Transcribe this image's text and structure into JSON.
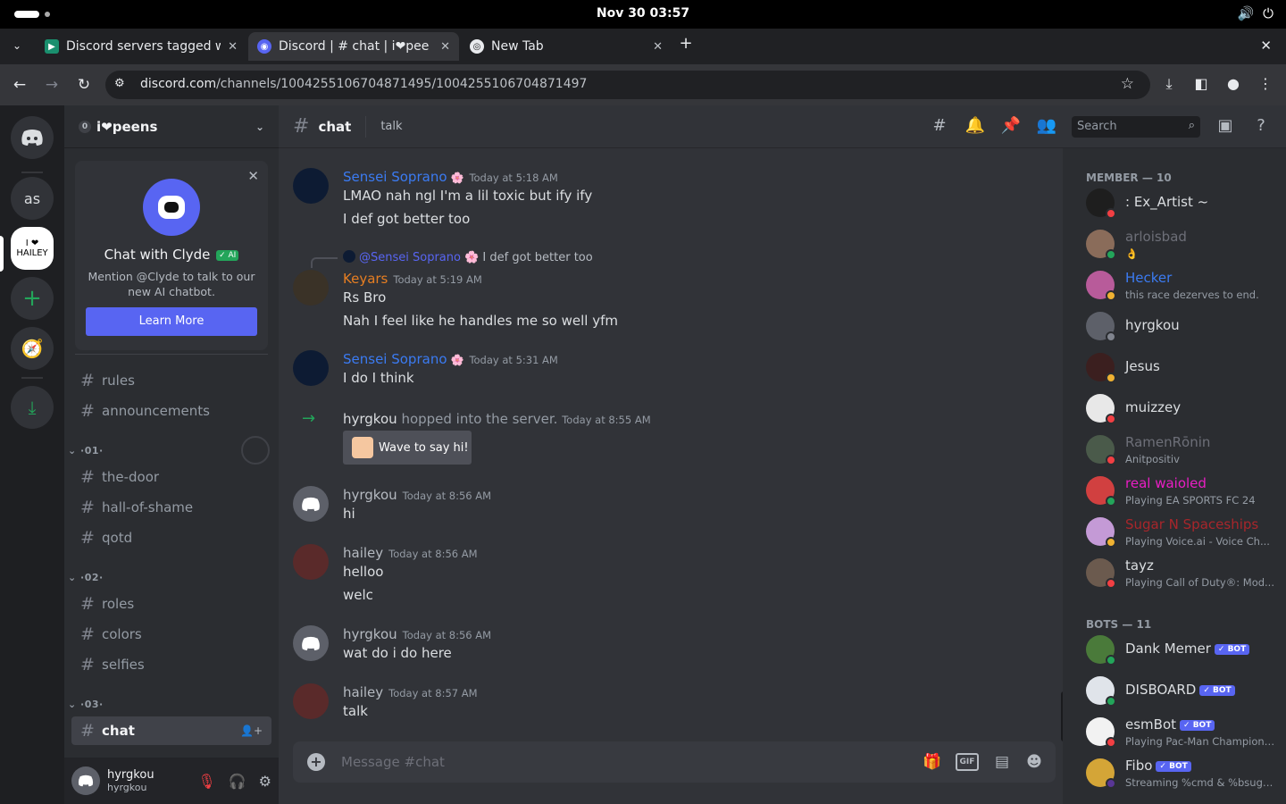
{
  "system": {
    "clock": "Nov 30  03:57",
    "volume_icon": "volume-icon",
    "power_icon": "power-icon"
  },
  "browser": {
    "tabs": [
      {
        "label": "Discord servers tagged w",
        "active": false
      },
      {
        "label": "Discord | # chat | i❤pee",
        "active": true
      },
      {
        "label": "New Tab",
        "active": false
      }
    ],
    "url_host": "discord.com",
    "url_path": "/channels/1004255106704871495/1004255106704871497"
  },
  "servers": {
    "as_label": "as",
    "hailey_label": "I ❤ HAILEY"
  },
  "server": {
    "name": "i❤peens",
    "boost": "0",
    "clyde": {
      "title": "Chat with Clyde",
      "ai_badge": "✓ AI",
      "description": "Mention @Clyde to talk to our new AI chatbot.",
      "button": "Learn More"
    },
    "channels_top": [
      "rules",
      "announcements"
    ],
    "categories": [
      {
        "name": "·01·",
        "channels": [
          "the-door",
          "hall-of-shame",
          "qotd"
        ]
      },
      {
        "name": "·02·",
        "channels": [
          "roles",
          "colors",
          "selfies"
        ]
      },
      {
        "name": "·03·",
        "channels": [
          "chat"
        ]
      }
    ]
  },
  "user": {
    "name": "hyrgkou",
    "tag": "hyrgkou"
  },
  "channel": {
    "name": "chat",
    "topic": "talk",
    "search_placeholder": "Search"
  },
  "messages": [
    {
      "author": "Sensei Soprano",
      "color": "#3b7bf2",
      "time": "Today at 5:18 AM",
      "lines": [
        "LMAO nah ngl I'm a lil toxic but ify ify",
        "I def got better too"
      ]
    },
    {
      "reply_to": "@Sensei Soprano",
      "reply_text": "I def got better too",
      "author": "Keyars",
      "color": "#e67e22",
      "time": "Today at 5:19 AM",
      "lines": [
        "Rs Bro",
        "Nah I feel like he handles me so well yfm"
      ]
    },
    {
      "author": "Sensei Soprano",
      "color": "#3b7bf2",
      "time": "Today at 5:31 AM",
      "lines": [
        "I do I think"
      ]
    },
    {
      "author": "hyrgkou",
      "color": "#b5bac1",
      "time": "Today at 8:56 AM",
      "lines": [
        "hi"
      ]
    },
    {
      "author": "hailey",
      "color": "#b5bac1",
      "time": "Today at 8:56 AM",
      "lines": [
        "helloo",
        "welc"
      ]
    },
    {
      "author": "hyrgkou",
      "color": "#b5bac1",
      "time": "Today at 8:56 AM",
      "lines": [
        "wat do i do here"
      ]
    },
    {
      "author": "hailey",
      "color": "#b5bac1",
      "time": "Today at 8:57 AM",
      "lines": [
        "talk"
      ]
    }
  ],
  "join_event": {
    "user": "hyrgkou",
    "text": "hopped into the server.",
    "time": "Today at 8:55 AM",
    "button": "Wave to say hi!"
  },
  "composer": {
    "placeholder": "Message #chat"
  },
  "members": {
    "member_header": "MEMBER — 10",
    "bots_header": "BOTS — 11",
    "list": [
      {
        "name": ": Ex_Artist ~",
        "status": "",
        "name_color": "#dbdee1",
        "status_color": "#f23f43"
      },
      {
        "name": "arloisbad",
        "status": "👌",
        "name_color": "#6d6f78",
        "status_color": "#23a55a"
      },
      {
        "name": "Hecker",
        "status": "this race dezerves to end.",
        "name_color": "#3b7bf2",
        "status_color": "#f0b232"
      },
      {
        "name": "hyrgkou",
        "status": "",
        "name_color": "#dbdee1",
        "status_color": "#80848e"
      },
      {
        "name": "Jesus",
        "status": "",
        "name_color": "#dbdee1",
        "status_color": "#f0b232"
      },
      {
        "name": "muizzey",
        "status": "",
        "name_color": "#dbdee1",
        "status_color": "#f23f43"
      },
      {
        "name": "RamenRōnin",
        "status": "Anitpositiv",
        "name_color": "#6d6f78",
        "status_color": "#f23f43"
      },
      {
        "name": "real waioled",
        "status": "Playing EA SPORTS FC 24",
        "name_color": "#e91ec4",
        "status_color": "#23a55a"
      },
      {
        "name": "Sugar N Spaceships",
        "status": "Playing Voice.ai - Voice Ch...",
        "name_color": "#a8262b",
        "status_color": "#f0b232"
      },
      {
        "name": "tayz",
        "status": "Playing Call of Duty®: Mod...",
        "name_color": "#dbdee1",
        "status_color": "#f23f43"
      }
    ],
    "bots": [
      {
        "name": "Dank Memer",
        "badge": "✓ BOT",
        "status": "",
        "status_color": "#23a55a"
      },
      {
        "name": "DISBOARD",
        "badge": "✓ BOT",
        "status": "",
        "status_color": "#23a55a"
      },
      {
        "name": "esmBot",
        "badge": "✓ BOT",
        "status": "Playing Pac-Man Champions...",
        "status_color": "#f23f43"
      },
      {
        "name": "Fibo",
        "badge": "✓ BOT",
        "status": "Streaming %cmd & %bsugges...",
        "status_color": "#593695"
      }
    ]
  }
}
